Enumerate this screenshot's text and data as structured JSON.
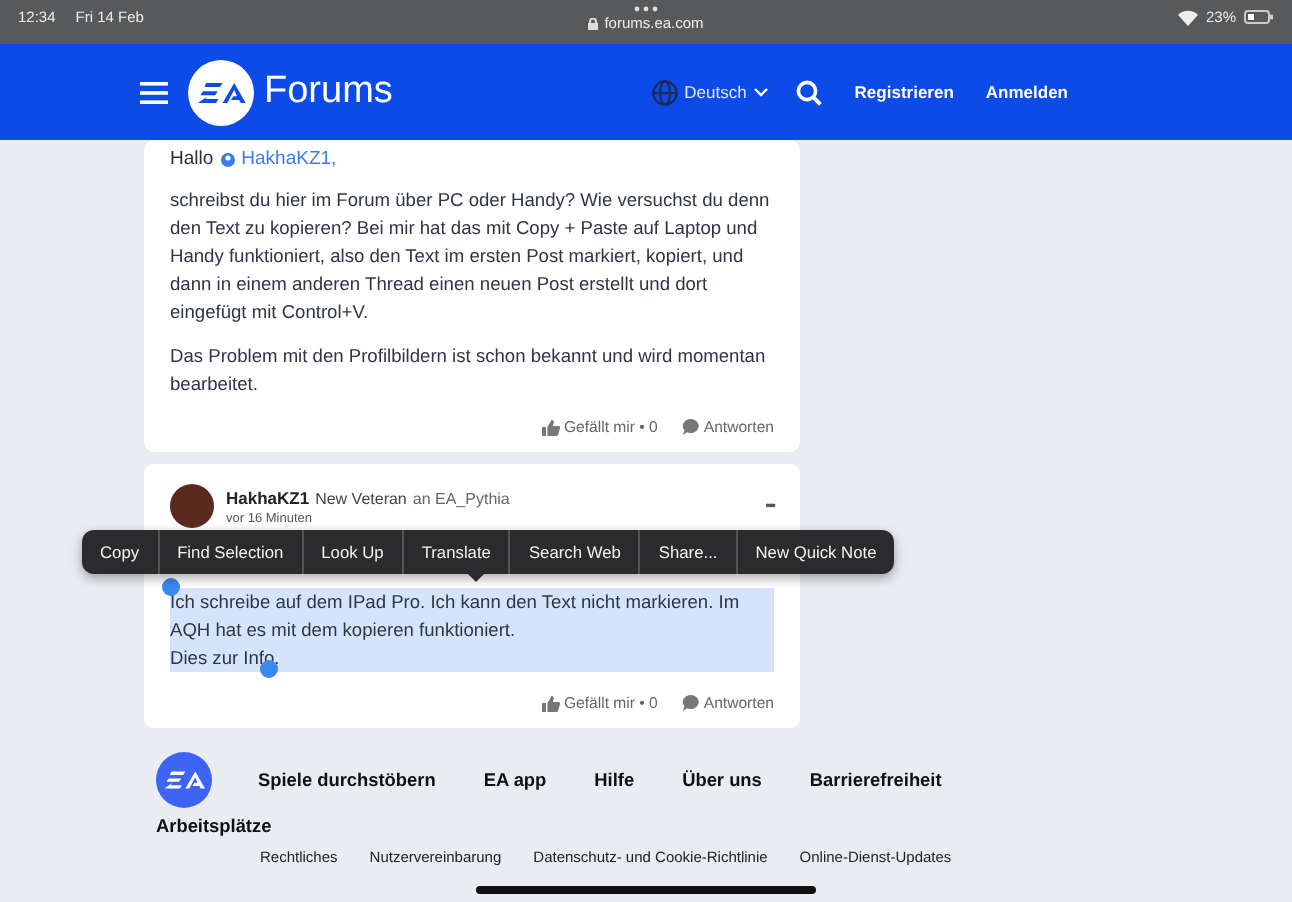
{
  "status_bar": {
    "time": "12:34",
    "date": "Fri 14 Feb",
    "url": "forums.ea.com",
    "battery": "23%"
  },
  "header": {
    "logo_text": "Forums",
    "language": "Deutsch",
    "links": [
      "Registrieren",
      "Anmelden"
    ]
  },
  "posts": [
    {
      "kind": "reply",
      "greeting": "Hallo",
      "mention": "HakhaKZ1,",
      "paragraphs": [
        {
          "text": "schreibst du hier im Forum über PC oder Handy? Wie versuchst du denn den Text zu kopieren? Bei mir hat das mit Copy + Paste auf Laptop und Handy funktioniert, also den Text im ersten Post markiert, kopiert, und dann in einem anderen Thread einen neuen Post erstellt und dort eingefügt mit Control+V.",
          "selected": false
        },
        {
          "text": "Das Problem mit den Profilbildern ist schon bekannt und wird momentan bearbeitet.",
          "selected": false
        }
      ],
      "like": "Gefällt mir • 0",
      "reply": "Antworten"
    },
    {
      "kind": "authored",
      "author": "HakhaKZ1",
      "rank": "New Veteran",
      "recipient": "an EA_Pythia",
      "time": "vor 16 Minuten",
      "more": "•••",
      "paragraphs": [
        {
          "text": "Ich schreibe auf dem IPad Pro. Ich kann den Text nicht markieren. Im AQH hat es mit dem kopieren funktioniert.\nDies zur Info.",
          "selected": true
        }
      ],
      "like": "Gefällt mir • 0",
      "reply": "Antworten"
    }
  ],
  "context_menu": {
    "items": [
      "Copy",
      "Find Selection",
      "Look Up",
      "Translate",
      "Search Web",
      "Share...",
      "New Quick Note"
    ]
  },
  "footer": {
    "links": [
      "Spiele durchstöbern",
      "EA app",
      "Hilfe",
      "Über uns",
      "Barrierefreiheit",
      "Arbeitsplätze"
    ],
    "legal": [
      "Rechtliches",
      "Nutzervereinbarung",
      "Datenschutz- und Cookie-Richtlinie",
      "Online-Dienst-Updates"
    ]
  }
}
